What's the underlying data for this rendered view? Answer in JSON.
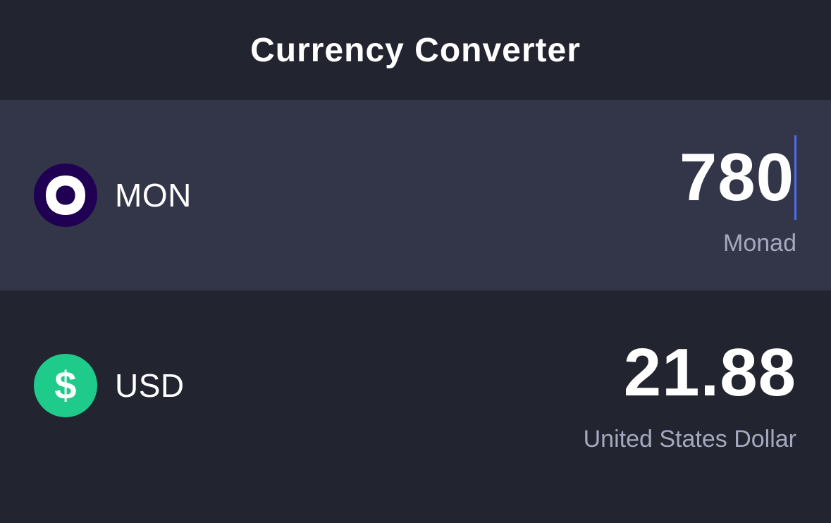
{
  "header": {
    "title": "Currency Converter"
  },
  "converter": {
    "source": {
      "code": "MON",
      "name": "Monad",
      "amount": "780",
      "icon": "monad-logo-icon",
      "icon_bg": "#200052",
      "active": true
    },
    "target": {
      "code": "USD",
      "name": "United States Dollar",
      "amount": "21.88",
      "icon": "dollar-icon",
      "icon_bg": "#1fcb8b",
      "icon_glyph": "$"
    }
  },
  "colors": {
    "background": "#22242f",
    "active_row": "#333648",
    "caret": "#4e6cf0",
    "secondary_text": "#a5a9bf"
  }
}
